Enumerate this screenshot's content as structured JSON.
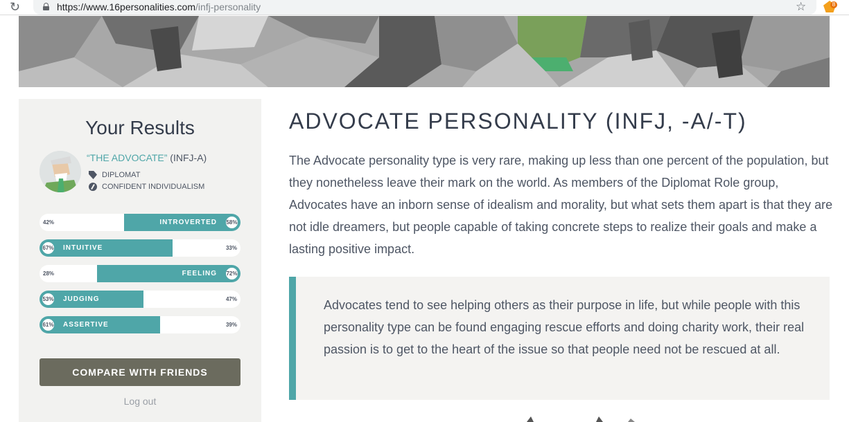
{
  "browser": {
    "url_domain": "https://www.16personalities.com",
    "url_path": "/infj-personality",
    "reload_glyph": "↻",
    "bookmark_glyph": "☆",
    "extension_badge": "8"
  },
  "sidebar": {
    "title": "Your Results",
    "type_name": "“THE ADVOCATE”",
    "type_code": " (INFJ-A)",
    "role": "DIPLOMAT",
    "strategy": "CONFIDENT INDIVIDUALISM",
    "traits": [
      {
        "label": "INTROVERTED",
        "left_pct": "42%",
        "right_pct": "58%",
        "value": 58,
        "side": "right"
      },
      {
        "label": "INTUITIVE",
        "left_pct": "67%",
        "right_pct": "33%",
        "value": 67,
        "side": "left"
      },
      {
        "label": "FEELING",
        "left_pct": "28%",
        "right_pct": "72%",
        "value": 72,
        "side": "right"
      },
      {
        "label": "JUDGING",
        "left_pct": "53%",
        "right_pct": "47%",
        "value": 53,
        "side": "left"
      },
      {
        "label": "ASSERTIVE",
        "left_pct": "61%",
        "right_pct": "39%",
        "value": 61,
        "side": "left"
      }
    ],
    "compare_label": "COMPARE WITH FRIENDS",
    "logout_label": "Log out"
  },
  "main": {
    "title": "ADVOCATE PERSONALITY (INFJ, -A/-T)",
    "intro": "The Advocate personality type is very rare, making up less than one percent of the population, but they nonetheless leave their mark on the world. As members of the Diplomat Role group, Advocates have an inborn sense of idealism and morality, but what sets them apart is that they are not idle dreamers, but people capable of taking concrete steps to realize their goals and make a lasting positive impact.",
    "quote": "Advocates tend to see helping others as their purpose in life, but while people with this personality type can be found engaging rescue efforts and doing charity work, their real passion is to get to the heart of the issue so that people need not be rescued at all."
  },
  "colors": {
    "accent": "#4fa6a8",
    "button": "#6b6b5e",
    "heading": "#343c4b",
    "body_text": "#4e5664",
    "panel_bg": "#f2f2f0"
  }
}
